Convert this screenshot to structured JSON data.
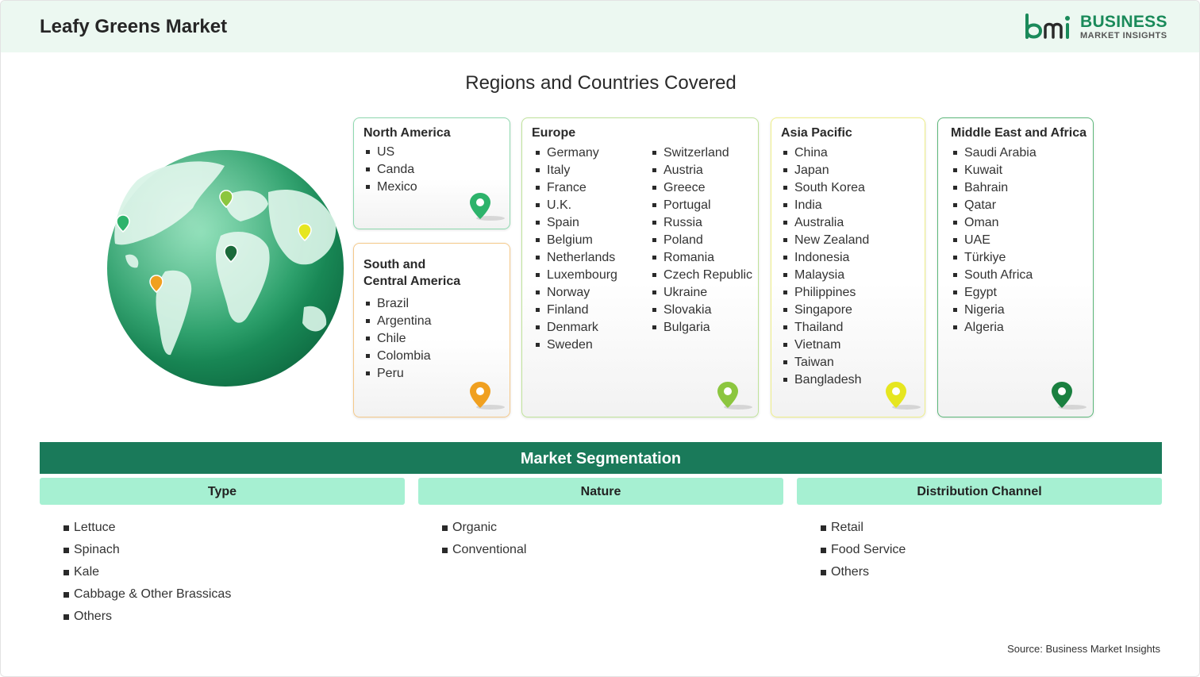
{
  "header": {
    "title": "Leafy Greens Market",
    "logo_line1": "BUSINESS",
    "logo_line2": "MARKET INSIGHTS"
  },
  "regions": {
    "title": "Regions and Countries Covered",
    "north_america": {
      "title": "North America",
      "countries": [
        "US",
        "Canda",
        "Mexico"
      ],
      "pin_color": "#2db36b"
    },
    "south_america": {
      "title": "South and\nCentral America",
      "countries": [
        "Brazil",
        "Argentina",
        "Chile",
        "Colombia",
        "Peru"
      ],
      "pin_color": "#f0a020"
    },
    "europe": {
      "title": "Europe",
      "countries_col1": [
        "Germany",
        "Italy",
        "France",
        "U.K.",
        "Spain",
        "Belgium",
        "Netherlands",
        "Luxembourg",
        "Norway",
        "Finland",
        "Denmark",
        "Sweden"
      ],
      "countries_col2": [
        "Switzerland",
        "Austria",
        "Greece",
        "Portugal",
        "Russia",
        "Poland",
        "Romania",
        "Czech Republic",
        "Ukraine",
        "Slovakia",
        "Bulgaria"
      ],
      "pin_color": "#8cc63f"
    },
    "asia_pacific": {
      "title": "Asia Pacific",
      "countries": [
        "China",
        "Japan",
        "South Korea",
        "India",
        "Australia",
        "New Zealand",
        "Indonesia",
        "Malaysia",
        "Philippines",
        "Singapore",
        "Thailand",
        "Vietnam",
        "Taiwan",
        "Bangladesh"
      ],
      "pin_color": "#e6e620"
    },
    "mea": {
      "title": "Middle East and Africa",
      "countries": [
        "Saudi Arabia",
        "Kuwait",
        "Bahrain",
        "Qatar",
        "Oman",
        "UAE",
        "Türkiye",
        "South Africa",
        "Egypt",
        "Nigeria",
        "Algeria"
      ],
      "pin_color": "#1a8040"
    }
  },
  "segmentation": {
    "title": "Market Segmentation",
    "columns": [
      {
        "header": "Type",
        "items": [
          "Lettuce",
          "Spinach",
          "Kale",
          "Cabbage & Other Brassicas",
          "Others"
        ]
      },
      {
        "header": "Nature",
        "items": [
          "Organic",
          "Conventional"
        ]
      },
      {
        "header": "Distribution Channel",
        "items": [
          "Retail",
          "Food Service",
          "Others"
        ]
      }
    ]
  },
  "source": "Source: Business Market Insights",
  "colors": {
    "header_bg": "#ecf8f1",
    "accent_dark": "#1a7a5a",
    "accent_light": "#a6f0d2",
    "na_border": "#8fd9b0",
    "sa_border": "#f5c98a",
    "eu_border": "#bfe39a",
    "ap_border": "#eeee88",
    "mea_border": "#5cb87a"
  }
}
